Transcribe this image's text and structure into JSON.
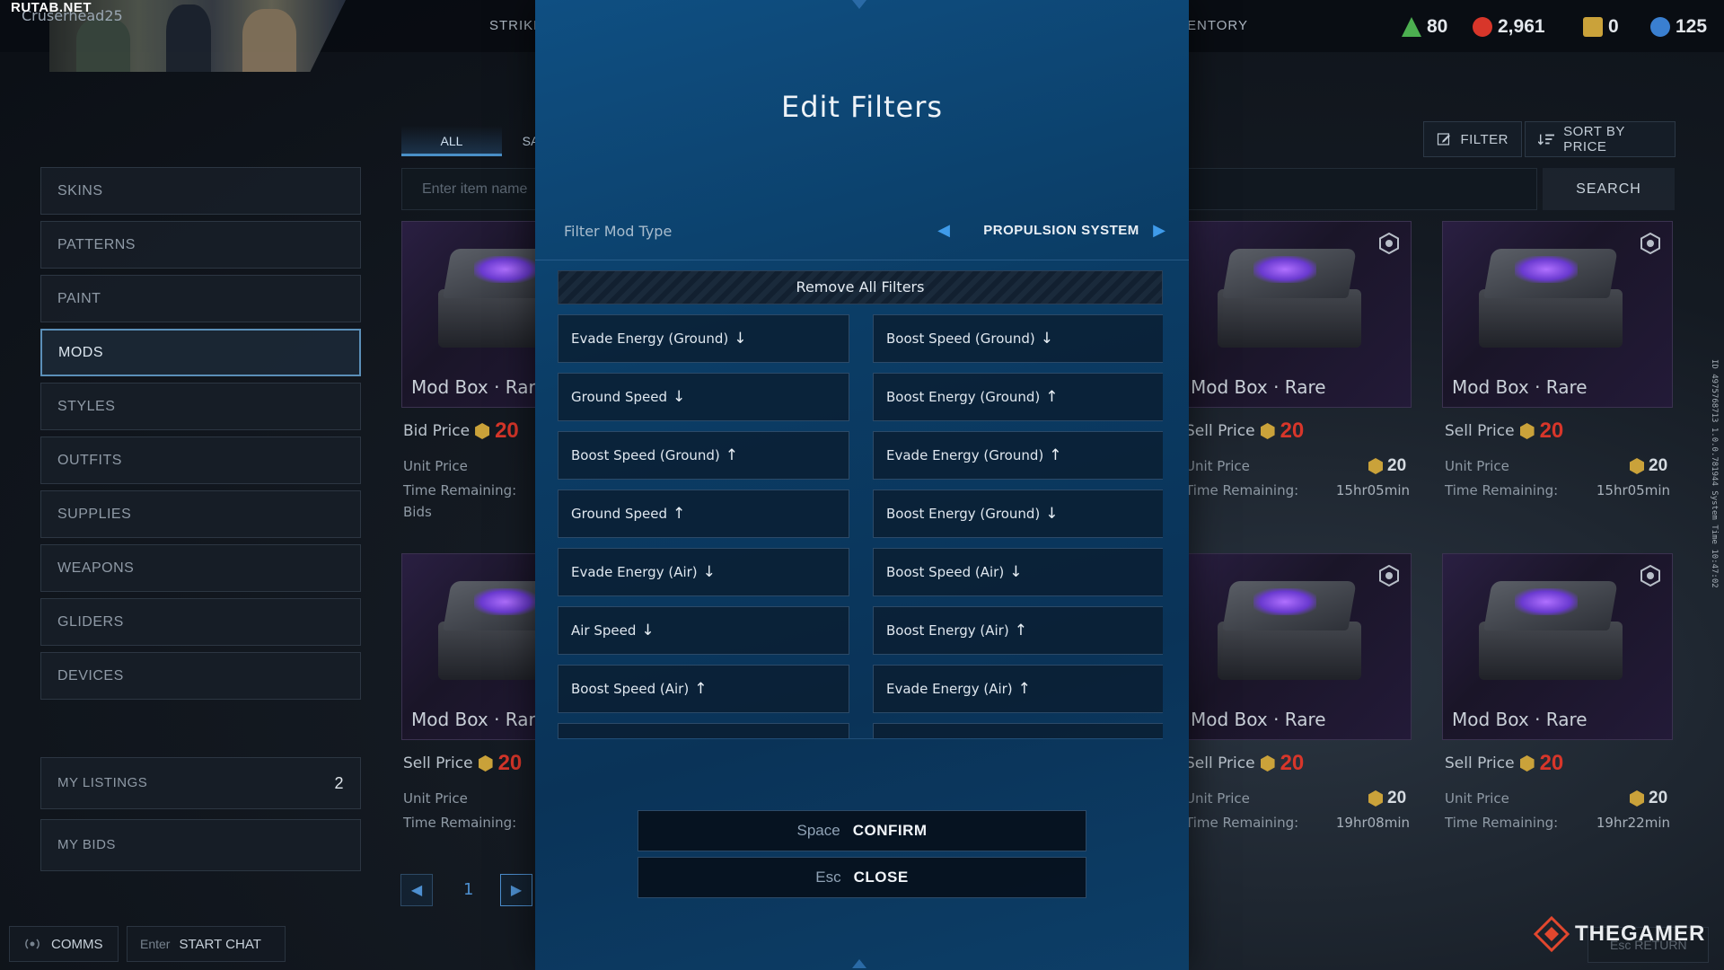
{
  "watermark_top": "RUTAB.NET",
  "player_name": "Cruserhead25",
  "nav": {
    "strike": "STRIKE",
    "inventory": "ENTORY"
  },
  "currencies": [
    {
      "icon": "triangle-currency-icon",
      "value": "80",
      "color": "#4caf50"
    },
    {
      "icon": "red-currency-icon",
      "value": "2,961",
      "color": "#d8362a"
    },
    {
      "icon": "gold-currency-icon",
      "value": "0",
      "color": "#caa23a"
    },
    {
      "icon": "blue-currency-icon",
      "value": "125",
      "color": "#3a7fd0"
    }
  ],
  "sidebar": {
    "items": [
      {
        "label": "SKINS"
      },
      {
        "label": "PATTERNS"
      },
      {
        "label": "PAINT"
      },
      {
        "label": "MODS"
      },
      {
        "label": "STYLES"
      },
      {
        "label": "OUTFITS"
      },
      {
        "label": "SUPPLIES"
      },
      {
        "label": "WEAPONS"
      },
      {
        "label": "GLIDERS"
      },
      {
        "label": "DEVICES"
      }
    ],
    "active": "MODS",
    "my_listings": {
      "label": "MY LISTINGS",
      "count": "2"
    },
    "my_bids": {
      "label": "MY BIDS"
    }
  },
  "market": {
    "tabs": [
      {
        "label": "ALL"
      },
      {
        "label": "SA"
      }
    ],
    "search_placeholder": "Enter item name",
    "search_button": "SEARCH",
    "filter_button": "FILTER",
    "sort_button": "SORT BY PRICE",
    "cards": [
      {
        "title": "Mod Box · Rare",
        "price_label": "Bid Price",
        "price": "20",
        "unit_label": "Unit Price",
        "unit_value": "",
        "time_label": "Time Remaining:",
        "time": "",
        "extra": "Bids"
      },
      {
        "title": "Mod Box · Rare",
        "price_label": "Sell Price",
        "price": "20",
        "unit_label": "Unit Price",
        "unit_value": "20",
        "time_label": "Time Remaining:",
        "time": "15hr05min",
        "extra": ""
      },
      {
        "title": "Mod Box · Rare",
        "price_label": "Sell Price",
        "price": "20",
        "unit_label": "Unit Price",
        "unit_value": "20",
        "time_label": "Time Remaining:",
        "time": "15hr05min",
        "extra": ""
      },
      {
        "title": "Mod Box · Rare",
        "price_label": "Sell Price",
        "price": "20",
        "unit_label": "Unit Price",
        "unit_value": "",
        "time_label": "Time Remaining:",
        "time": "",
        "extra": ""
      },
      {
        "title": "Mod Box · Rare",
        "price_label": "Sell Price",
        "price": "20",
        "unit_label": "Unit Price",
        "unit_value": "20",
        "time_label": "Time Remaining:",
        "time": "19hr08min",
        "extra": ""
      },
      {
        "title": "Mod Box · Rare",
        "price_label": "Sell Price",
        "price": "20",
        "unit_label": "Unit Price",
        "unit_value": "20",
        "time_label": "Time Remaining:",
        "time": "19hr22min",
        "extra": ""
      }
    ],
    "page": "1"
  },
  "chat": {
    "comms": "COMMS",
    "enter_key": "Enter",
    "start_chat": "START CHAT"
  },
  "modal": {
    "title": "Edit Filters",
    "mod_type_label": "Filter Mod Type",
    "mod_type_value": "PROPULSION SYSTEM",
    "remove_all": "Remove All Filters",
    "filters": [
      {
        "label": "Evade Energy (Ground)",
        "dir": "↓"
      },
      {
        "label": "Boost Speed (Ground)",
        "dir": "↓"
      },
      {
        "label": "Ground Speed",
        "dir": "↓"
      },
      {
        "label": "Boost Energy (Ground)",
        "dir": "↑"
      },
      {
        "label": "Boost Speed (Ground)",
        "dir": "↑"
      },
      {
        "label": "Evade Energy (Ground)",
        "dir": "↑"
      },
      {
        "label": "Ground Speed",
        "dir": "↑"
      },
      {
        "label": "Boost Energy (Ground)",
        "dir": "↓"
      },
      {
        "label": "Evade Energy (Air)",
        "dir": "↓"
      },
      {
        "label": "Boost Speed (Air)",
        "dir": "↓"
      },
      {
        "label": "Air Speed",
        "dir": "↓"
      },
      {
        "label": "Boost Energy (Air)",
        "dir": "↑"
      },
      {
        "label": "Boost Speed (Air)",
        "dir": "↑"
      },
      {
        "label": "Evade Energy (Air)",
        "dir": "↑"
      },
      {
        "label": "",
        "dir": ""
      },
      {
        "label": "",
        "dir": ""
      }
    ],
    "confirm": {
      "key": "Space",
      "label": "CONFIRM"
    },
    "close": {
      "key": "Esc",
      "label": "CLOSE"
    }
  },
  "side_info": "ID 4975768713 1.0.0.781944 System Time 10:47:02",
  "watermark_bottom": "THEGAMER",
  "esc_return": {
    "key": "Esc",
    "label": "RETURN"
  }
}
